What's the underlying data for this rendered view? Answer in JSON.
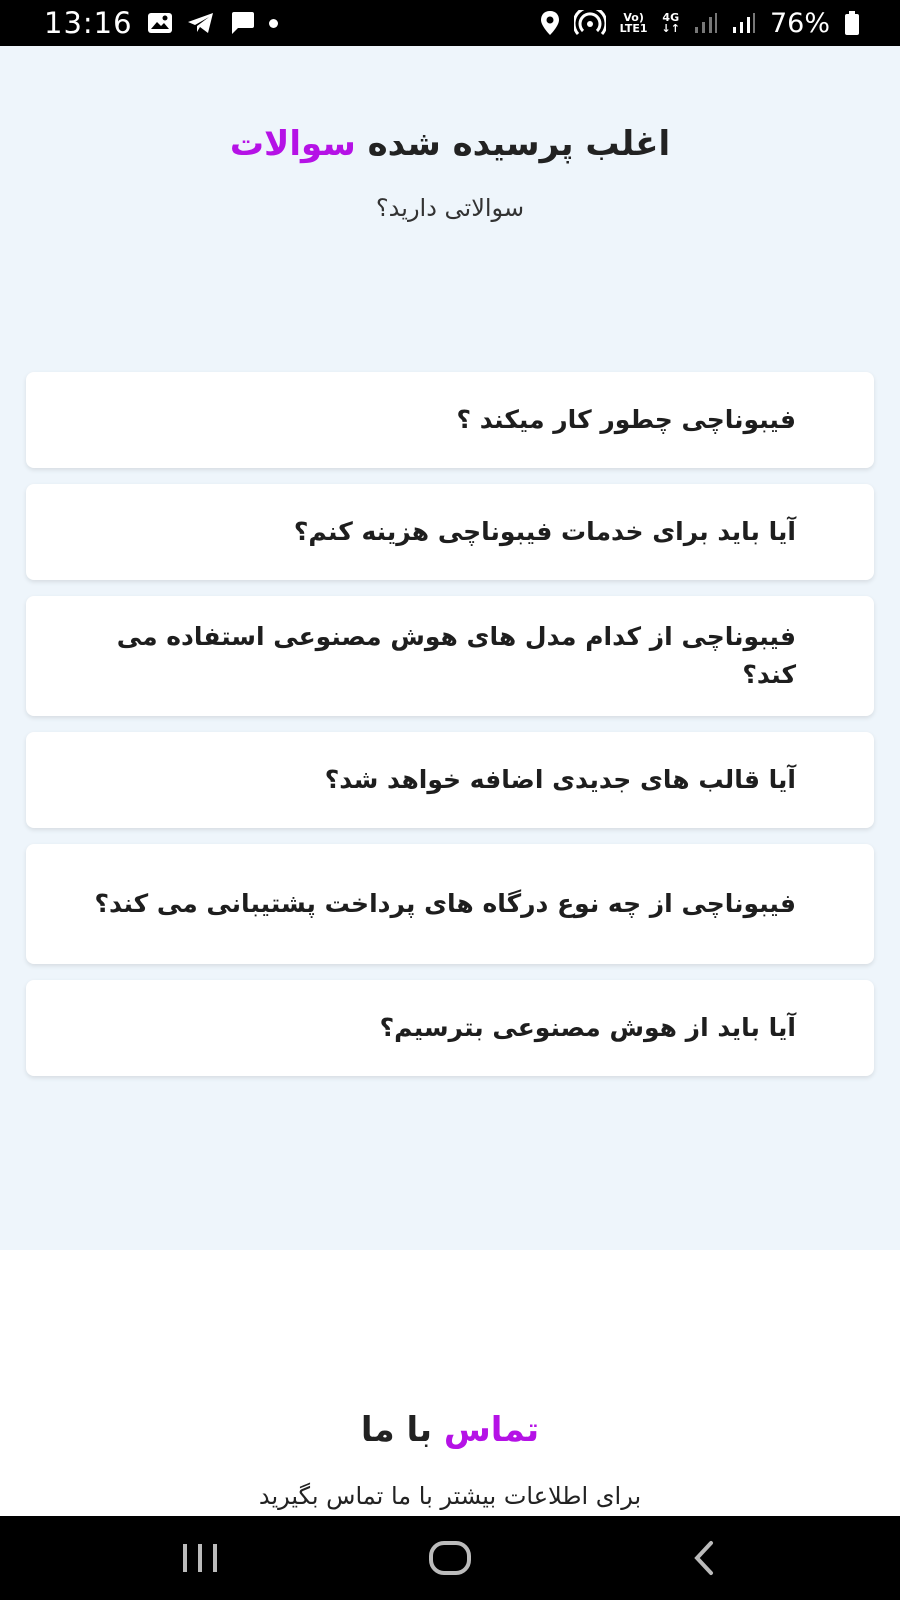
{
  "status_bar": {
    "time": "13:16",
    "network_top": "Vo)",
    "network_bottom": "LTE1",
    "data_type": "4G",
    "battery": "76%",
    "icons": [
      "gallery-icon",
      "telegram-icon",
      "chat-icon",
      "dot-icon",
      "location-icon",
      "hotspot-icon",
      "signal-icon",
      "signal-icon",
      "battery-icon"
    ]
  },
  "faq": {
    "title_main": "اغلب پرسیده شده ",
    "title_accent": "سوالات",
    "subtitle": "سوالاتی دارید؟",
    "items": [
      {
        "question": "فیبوناچی چطور کار میکند ؟"
      },
      {
        "question": "آیا باید برای خدمات فیبوناچی هزینه کنم؟"
      },
      {
        "question": "فیبوناچی از کدام مدل های هوش مصنوعی استفاده می کند؟"
      },
      {
        "question": "آیا قالب های جدیدی اضافه خواهد شد؟"
      },
      {
        "question": "فیبوناچی از چه نوع درگاه های پرداخت پشتیبانی می کند؟"
      },
      {
        "question": "آیا باید از هوش مصنوعی بترسیم؟"
      }
    ]
  },
  "contact": {
    "title_accent": "تماس",
    "title_main": " با ما",
    "text": "برای اطلاعات بیشتر با ما تماس بگیرید"
  },
  "colors": {
    "accent": "#b512e6",
    "section_bg": "#eef5fb",
    "card_bg": "#ffffff"
  },
  "nav_bar": {
    "icons": [
      "recent-apps-icon",
      "home-icon",
      "back-icon"
    ]
  }
}
